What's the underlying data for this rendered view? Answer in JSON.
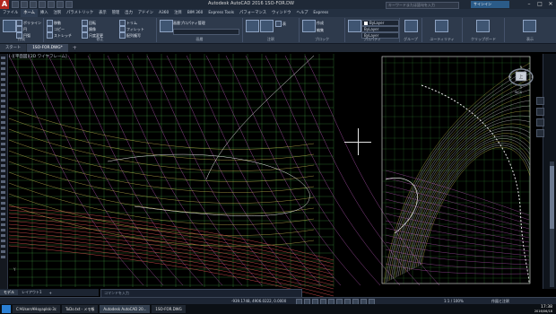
{
  "titlebar": {
    "app_logo": "A",
    "title": "Autodesk AutoCAD 2016   1SO-FOR.DW",
    "search_placeholder": "キーワードまたは語句を入力",
    "user": "サインイン",
    "minimize": "–",
    "maximize": "□",
    "close": "✕"
  },
  "menubar": {
    "tabs": [
      "ファイル",
      "ホーム",
      "挿入",
      "注釈",
      "パラメトリック",
      "表示",
      "管理",
      "出力",
      "アドイン",
      "A360",
      "注目",
      "BIM 360",
      "Express Tools",
      "パフォーマンス",
      "ウィンドウ",
      "ヘルプ",
      "Express"
    ]
  },
  "ribbon": {
    "groups": [
      {
        "label": "作成"
      },
      {
        "label": "修正"
      },
      {
        "label": "画層"
      },
      {
        "label": "注釈"
      },
      {
        "label": "ブロック"
      },
      {
        "label": "プロパティ"
      },
      {
        "label": "グループ"
      },
      {
        "label": "ユーティリティ"
      },
      {
        "label": "クリップボード"
      },
      {
        "label": "表示"
      }
    ],
    "items": {
      "line": "線分",
      "polyline": "ポリライン",
      "circle": "円",
      "arc": "円弧",
      "move": "移動",
      "copy": "コピー",
      "stretch": "ストレッチ",
      "rotate": "回転",
      "mirror": "鏡像",
      "scale": "尺度変更",
      "trim": "トリム",
      "fillet": "フィレット",
      "array": "配列複写",
      "layer_props": "画層プロパティ管理",
      "text": "文字",
      "dimension": "寸法記入",
      "table": "表",
      "insert": "挿入",
      "create": "作成",
      "edit": "編集",
      "match": "プロパティコピー",
      "group": "グループ",
      "measure": "計測",
      "paste": "貼り付け",
      "base": "ベース"
    },
    "combos": {
      "color": "ByLayer",
      "linetype": "ByLayer",
      "lineweight": "ByLayer"
    }
  },
  "doc_tabs": {
    "start": "スタート",
    "active": "1SO-FOR.DWG*",
    "add": "+"
  },
  "viewport": {
    "label": "[-][平面図][2D ワイヤフレーム]",
    "viewcube_top": "上",
    "viewcube_n": "N",
    "viewcube_s": "S",
    "viewcube_w": "W",
    "viewcube_e": "E",
    "wcs": "WCS",
    "ucs_label": "Y"
  },
  "layout_tabs": {
    "model": "モデル",
    "layout1": "レイアウト1",
    "add": "+"
  },
  "command": {
    "placeholder": "コマンドを入力"
  },
  "status": {
    "coords": "-939.1748, 4906.0222, 0.0000",
    "model": "モデル",
    "scale": "1:1 / 100%",
    "workspace": "作図と注釈"
  },
  "taskbar": {
    "items": [
      {
        "label": "C:¥Users¥Hoyaplsk-3c"
      },
      {
        "label": "ToDo.txt - メモ帳"
      },
      {
        "label": "Autodesk AutoCAD 20..."
      },
      {
        "label": "1SO-FOR.DWG"
      }
    ],
    "time": "17:38",
    "date": "2016/06/18"
  },
  "colors": {
    "grid_green": "#4fbf4f",
    "curve_magenta": "#c85ec8",
    "curve_yellow": "#e0d35a",
    "curve_white": "#e8e8e8",
    "curve_red": "#e05050",
    "accent_red": "#b3261e"
  }
}
